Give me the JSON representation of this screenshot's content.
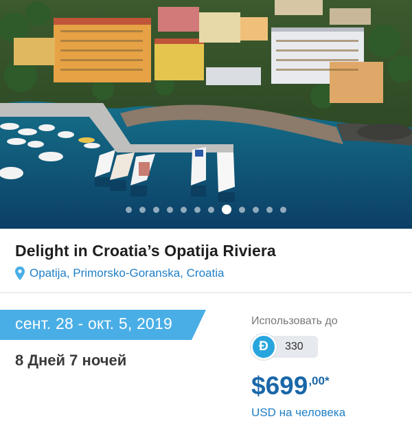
{
  "tour": {
    "title": "Delight in Croatia’s Opatija Riviera",
    "location": "Opatija, Primorsko-Goranska, Croatia",
    "dates": "сент. 28 - окт. 5, 2019",
    "duration": "8 Дней 7 ночей"
  },
  "carousel": {
    "total_slides": 12,
    "active_slide": 8
  },
  "payment": {
    "use_label": "Использовать до",
    "coin_symbol": "Đ",
    "coin_amount": "330",
    "price_main": "$699",
    "price_cents": ",00*",
    "price_unit": "USD на человека"
  },
  "colors": {
    "accent_blue": "#4aaee6",
    "link_blue": "#1e7fc7",
    "price_blue": "#1a67a8",
    "coin_blue": "#29a5de"
  },
  "icons": {
    "location": "map-pin-icon",
    "coin": "dash-coin-icon"
  }
}
